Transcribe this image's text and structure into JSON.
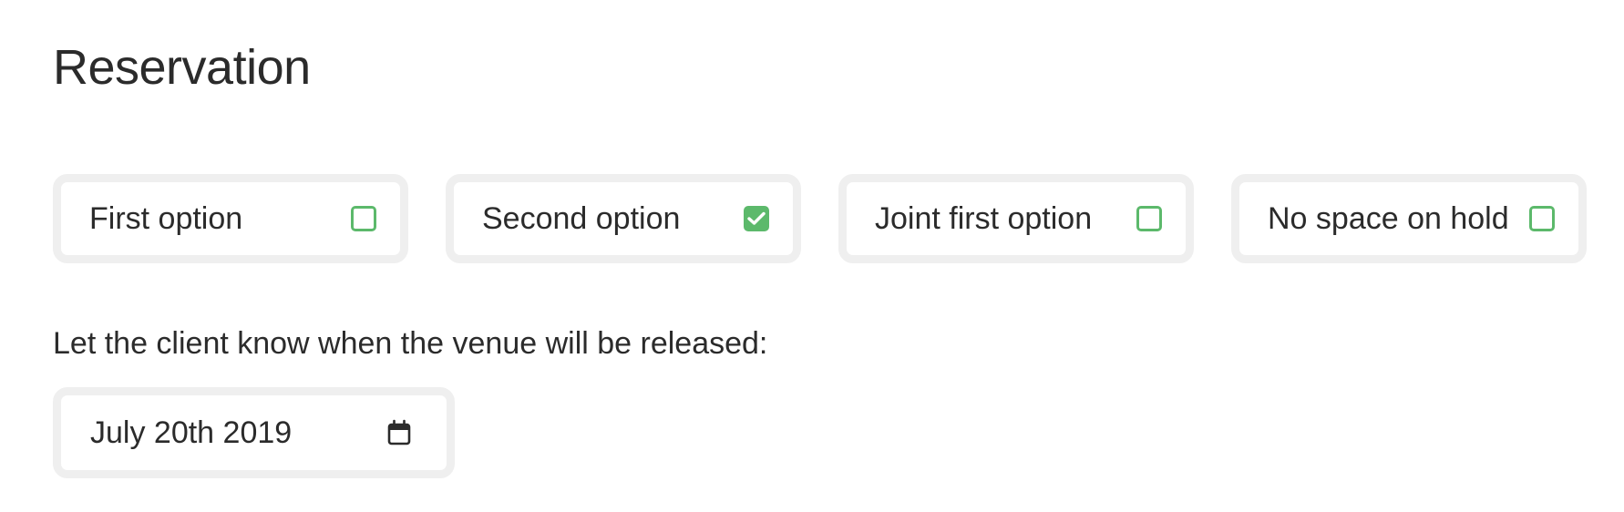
{
  "section": {
    "title": "Reservation"
  },
  "options": [
    {
      "label": "First option",
      "checked": false
    },
    {
      "label": "Second option",
      "checked": true
    },
    {
      "label": "Joint first option",
      "checked": false
    },
    {
      "label": "No space on hold",
      "checked": false
    }
  ],
  "release": {
    "label": "Let the client know when the venue will be released:",
    "date_value": "July 20th 2019",
    "icon": "calendar-icon"
  },
  "colors": {
    "accent": "#5cb96b",
    "border": "#efefef",
    "text": "#2b2b2b"
  }
}
